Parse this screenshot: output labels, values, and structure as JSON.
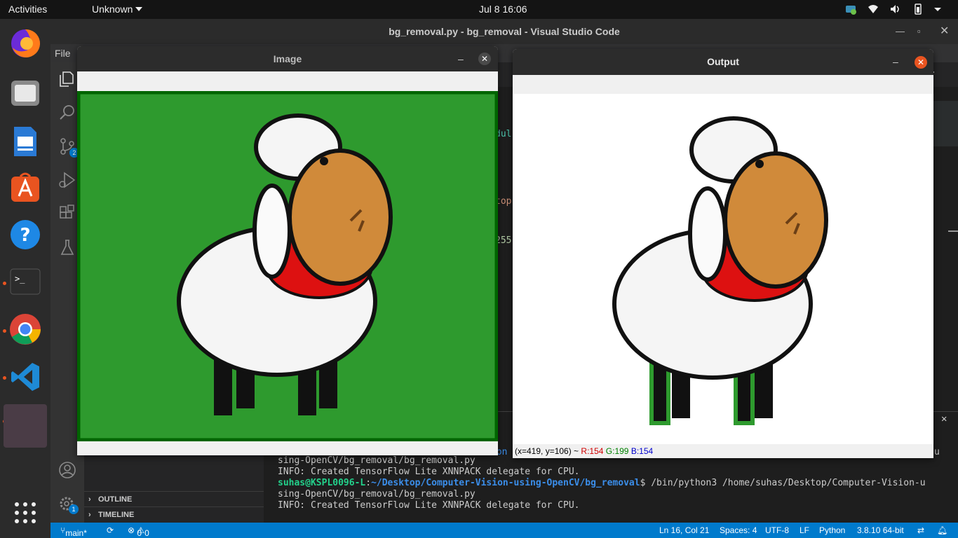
{
  "topbar": {
    "activities": "Activities",
    "app_menu": "Unknown",
    "clock": "Jul 8  16:06"
  },
  "vscode": {
    "window_title": "bg_removal.py - bg_removal - Visual Studio Code",
    "menu_file": "File",
    "scm_badge": "2",
    "settings_badge": "1",
    "outline_label": "OUTLINE",
    "timeline_label": "TIMELINE",
    "code_fragments": [
      "dul",
      "top",
      "255"
    ],
    "terminal_lines": [
      "sing-OpenCV/bg_removal/bg_removal.py",
      "INFO: Created TensorFlow Lite XNNPACK delegate for CPU.",
      "sing-OpenCV/bg_removal/bg_removal.py",
      "INFO: Created TensorFlow Lite XNNPACK delegate for CPU."
    ],
    "prompt": {
      "user": "suhas@KSPL0096-L",
      "sep": ":",
      "path": "~/Desktop/Computer-Vision-using-OpenCV/bg_removal",
      "cmd": "$ /bin/python3 /home/suhas/Desktop/Computer-Vision-u"
    },
    "terminal_side_fragment": "ion",
    "terminal_side_fragment2": "u",
    "status": {
      "branch": "main*",
      "errors": "0",
      "warnings": "0",
      "position": "Ln 16, Col 21",
      "spaces": "Spaces: 4",
      "encoding": "UTF-8",
      "eol": "LF",
      "language": "Python",
      "interpreter": "3.8.10 64-bit"
    }
  },
  "image_window": {
    "title": "Image",
    "background_color": "#2e9a2e",
    "border_color": "#006400"
  },
  "output_window": {
    "title": "Output",
    "pixel_info": "(x=419, y=106) ~",
    "r": "R:154",
    "g": "G:199",
    "b": "B:154"
  },
  "colors": {
    "accent": "#007acc",
    "ubuntu_orange": "#e95420"
  }
}
